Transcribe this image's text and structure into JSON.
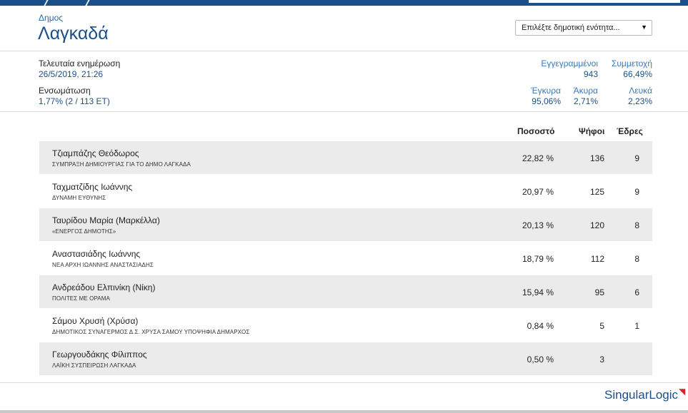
{
  "municipality": {
    "kind": "Δημος",
    "name": "Λαγκαδά"
  },
  "unit_select": {
    "value": "Επιλέξτε δημοτική ενότητα..."
  },
  "stats": {
    "last_update_label": "Τελευταία ενημέρωση",
    "last_update_value": "26/5/2019, 21:26",
    "integration_label": "Ενσωμάτωση",
    "integration_value": "1,77% (2 / 113 ΕΤ)",
    "registered_label": "Εγγεγραμμένοι",
    "registered_value": "943",
    "turnout_label": "Συμμετοχή",
    "turnout_value": "66,49%",
    "valid_label": "Έγκυρα",
    "valid_value": "95,06%",
    "invalid_label": "Άκυρα",
    "invalid_value": "2,71%",
    "blank_label": "Λευκά",
    "blank_value": "2,23%"
  },
  "table": {
    "headers": {
      "percent": "Ποσοστό",
      "votes": "Ψήφοι",
      "seats": "Έδρες"
    },
    "rows": [
      {
        "candidate": "Τζιαμπάζης Θεόδωρος",
        "party": "ΣΥΜΠΡΑΞΗ ΔΗΜΙΟΥΡΓΙΑΣ ΓΙΑ ΤΟ ΔΗΜΟ ΛΑΓΚΑΔΑ",
        "percent": "22,82 %",
        "votes": "136",
        "seats": "9"
      },
      {
        "candidate": "Ταχματζίδης Ιωάννης",
        "party": "ΔΥΝΑΜΗ ΕΥΘΥΝΗΣ",
        "percent": "20,97 %",
        "votes": "125",
        "seats": "9"
      },
      {
        "candidate": "Ταυρίδου Μαρία (Μαρκέλλα)",
        "party": "«ΕΝΕΡΓΟΣ ΔΗΜΟΤΗΣ»",
        "percent": "20,13 %",
        "votes": "120",
        "seats": "8"
      },
      {
        "candidate": "Αναστασιάδης Ιωάννης",
        "party": "ΝΕΑ ΑΡΧΗ ΙΩΑΝΝΗΣ ΑΝΑΣΤΑΣΙΑΔΗΣ",
        "percent": "18,79 %",
        "votes": "112",
        "seats": "8"
      },
      {
        "candidate": "Ανδρεάδου Ελπινίκη (Νίκη)",
        "party": "ΠΟΛΙΤΕΣ ΜΕ ΟΡΑΜΑ",
        "percent": "15,94 %",
        "votes": "95",
        "seats": "6"
      },
      {
        "candidate": "Σάμου Χρυσή (Χρύσα)",
        "party": "ΔΗΜΟΤΙΚΟΣ ΣΥΝΑΓΕΡΜΟΣ Δ.Σ. ΧΡΥΣΑ ΣΑΜΟΥ ΥΠΟΨΗΦΙΑ ΔΗΜΑΡΧΟΣ",
        "percent": "0,84 %",
        "votes": "5",
        "seats": "1"
      },
      {
        "candidate": "Γεωργουδάκης Φίλιππος",
        "party": "ΛΑΪΚΗ ΣΥΣΠΕΙΡΩΣΗ ΛΑΓΚΑΔΑ",
        "percent": "0,50 %",
        "votes": "3",
        "seats": ""
      }
    ]
  },
  "footer": {
    "logo_text": "SingularLogic"
  },
  "colors": {
    "primary": "#1b4f8a",
    "link": "#3b78b6",
    "row_alt": "#ebebeb",
    "logo_accent": "#d8232a"
  }
}
